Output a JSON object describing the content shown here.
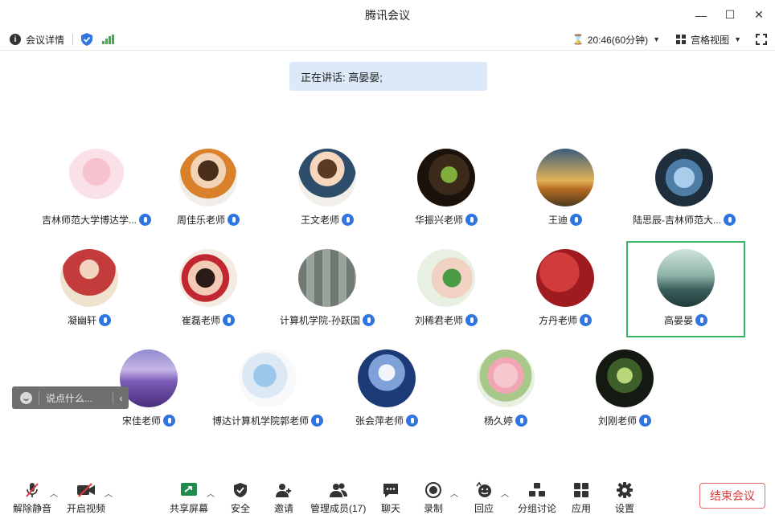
{
  "window": {
    "title": "腾讯会议",
    "minimize": "—",
    "maximize": "☐",
    "close": "✕"
  },
  "toolbar": {
    "meeting_details": "会议详情",
    "time_display": "20:46(60分钟)",
    "view_mode": "宫格视图"
  },
  "speaking": "正在讲话: 高晏晏;",
  "participants": [
    {
      "name": "吉林师范大学博达学..."
    },
    {
      "name": "周佳乐老师"
    },
    {
      "name": "王文老师"
    },
    {
      "name": "华振兴老师"
    },
    {
      "name": "王迪"
    },
    {
      "name": "陆思辰-吉林师范大..."
    },
    {
      "name": "凝幽轩"
    },
    {
      "name": "崔磊老师"
    },
    {
      "name": "计算机学院-孙跃国"
    },
    {
      "name": "刘稀君老师"
    },
    {
      "name": "方丹老师"
    },
    {
      "name": "高晏晏"
    },
    {
      "name": "宋佳老师"
    },
    {
      "name": "博达计算机学院郭老师"
    },
    {
      "name": "张会萍老师"
    },
    {
      "name": "杨久婷"
    },
    {
      "name": "刘刚老师"
    }
  ],
  "chat": {
    "placeholder": "说点什么..."
  },
  "bottom": {
    "unmute": "解除静音",
    "start_video": "开启视频",
    "share_screen": "共享屏幕",
    "security": "安全",
    "invite": "邀请",
    "manage_members": "管理成员(17)",
    "chat": "聊天",
    "record": "录制",
    "reaction": "回应",
    "breakout": "分组讨论",
    "apps": "应用",
    "settings": "设置",
    "end_meeting": "结束会议"
  },
  "colors": {
    "accent": "#2f74e0",
    "active_border": "#3ab36b",
    "speaking_bg": "#dce9f9",
    "end_red": "#d83b3b"
  }
}
